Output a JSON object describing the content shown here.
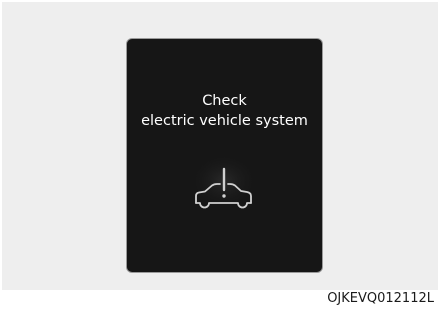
{
  "display": {
    "message_line1": "Check",
    "message_line2": "electric vehicle system",
    "icon": "car-warning-icon",
    "screen_color": "#161616",
    "text_color": "#ffffff"
  },
  "figure": {
    "code": "OJKEVQ012112L"
  }
}
